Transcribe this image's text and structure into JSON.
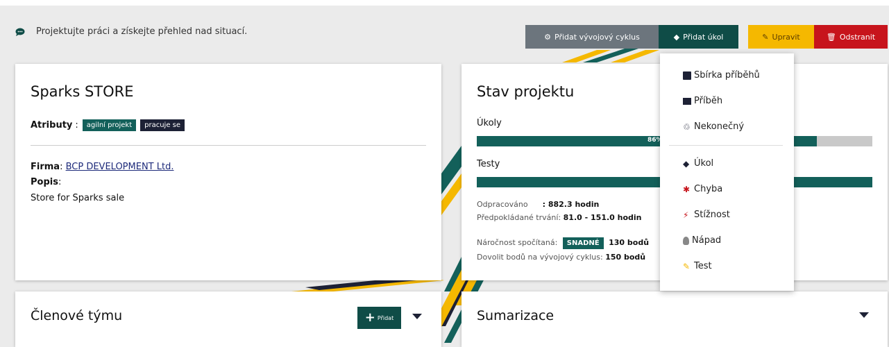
{
  "info": {
    "text": "Projektujte práci a získejte přehled nad situací."
  },
  "actions": {
    "add_cycle": "Přidat vývojový cyklus",
    "add_task": "Přidat úkol",
    "edit": "Upravit",
    "delete": "Odstranit"
  },
  "project": {
    "title": "Sparks STORE",
    "attr_label": "Atributy",
    "tags": [
      "agilní projekt",
      "pracuje se"
    ],
    "firm_label": "Firma",
    "firm_value": "BCP DEVELOPMENT Ltd.",
    "desc_label": "Popis",
    "desc_value": "Store for Sparks sale"
  },
  "status": {
    "title": "Stav projektu",
    "tasks_label": "Úkoly",
    "tasks_progress": 0.86,
    "tasks_pct_text": "86%",
    "tests_label": "Testy",
    "tests_progress": 1.0,
    "worked_label": "Odpracováno",
    "worked_value": ": 882.3 hodin",
    "expected_label": "Předpokládané trvání:",
    "expected_value": "81.0 - 151.0 hodin",
    "difficulty_label": "Náročnost spočítaná:",
    "difficulty_badge": "SNADNÉ",
    "difficulty_value": "130 bodů",
    "allow_label": "Dovolit bodů na vývojový cyklus:",
    "allow_value": "150 bodů"
  },
  "team": {
    "title": "Členové týmu",
    "add": "Přidat"
  },
  "summary": {
    "title": "Sumarizace"
  },
  "dropdown": {
    "items": [
      "Sbírka příběhů",
      "Příběh",
      "Nekonečný",
      "Úkol",
      "Chyba",
      "Stížnost",
      "Nápad",
      "Test"
    ]
  },
  "colors": {
    "teal": "#13605a",
    "dark_teal": "#0f4c47",
    "yellow": "#f5b800",
    "red": "#c7141c",
    "grey": "#6c757d",
    "navy": "#1d2135"
  }
}
